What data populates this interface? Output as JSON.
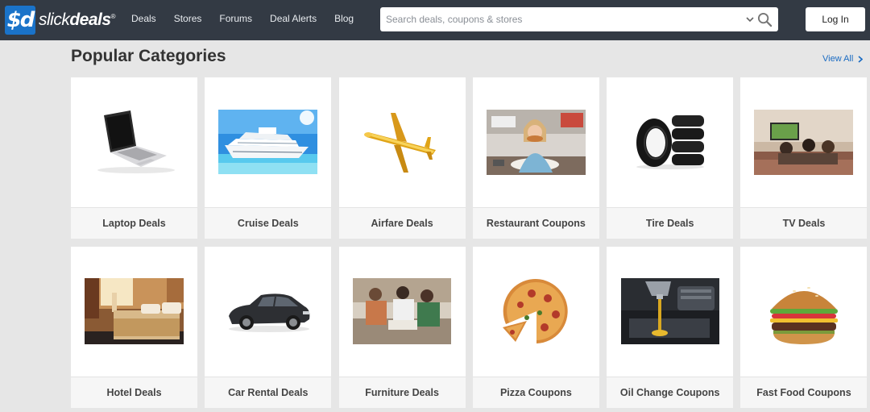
{
  "brand": {
    "mark": "$d",
    "name_light": "slick",
    "name_bold": "deals",
    "mark_symbol": "®"
  },
  "nav": [
    "Deals",
    "Stores",
    "Forums",
    "Deal Alerts",
    "Blog"
  ],
  "search": {
    "placeholder": "Search deals, coupons & stores",
    "value": ""
  },
  "login_label": "Log In",
  "section": {
    "title": "Popular Categories",
    "view_all": "View All"
  },
  "categories": [
    {
      "label": "Laptop Deals",
      "icon": "laptop-image"
    },
    {
      "label": "Cruise Deals",
      "icon": "cruise-ship-image"
    },
    {
      "label": "Airfare Deals",
      "icon": "airplane-image"
    },
    {
      "label": "Restaurant Coupons",
      "icon": "restaurant-image"
    },
    {
      "label": "Tire Deals",
      "icon": "tires-image"
    },
    {
      "label": "TV Deals",
      "icon": "tv-image"
    },
    {
      "label": "Hotel Deals",
      "icon": "hotel-room-image"
    },
    {
      "label": "Car Rental Deals",
      "icon": "car-image"
    },
    {
      "label": "Furniture Deals",
      "icon": "furniture-image"
    },
    {
      "label": "Pizza Coupons",
      "icon": "pizza-image"
    },
    {
      "label": "Oil Change Coupons",
      "icon": "oil-change-image"
    },
    {
      "label": "Fast Food Coupons",
      "icon": "burger-image"
    }
  ],
  "colors": {
    "topbar": "#333a44",
    "accent": "#1a73c9",
    "link": "#1a6bc2",
    "page_bg": "#e6e6e6"
  }
}
